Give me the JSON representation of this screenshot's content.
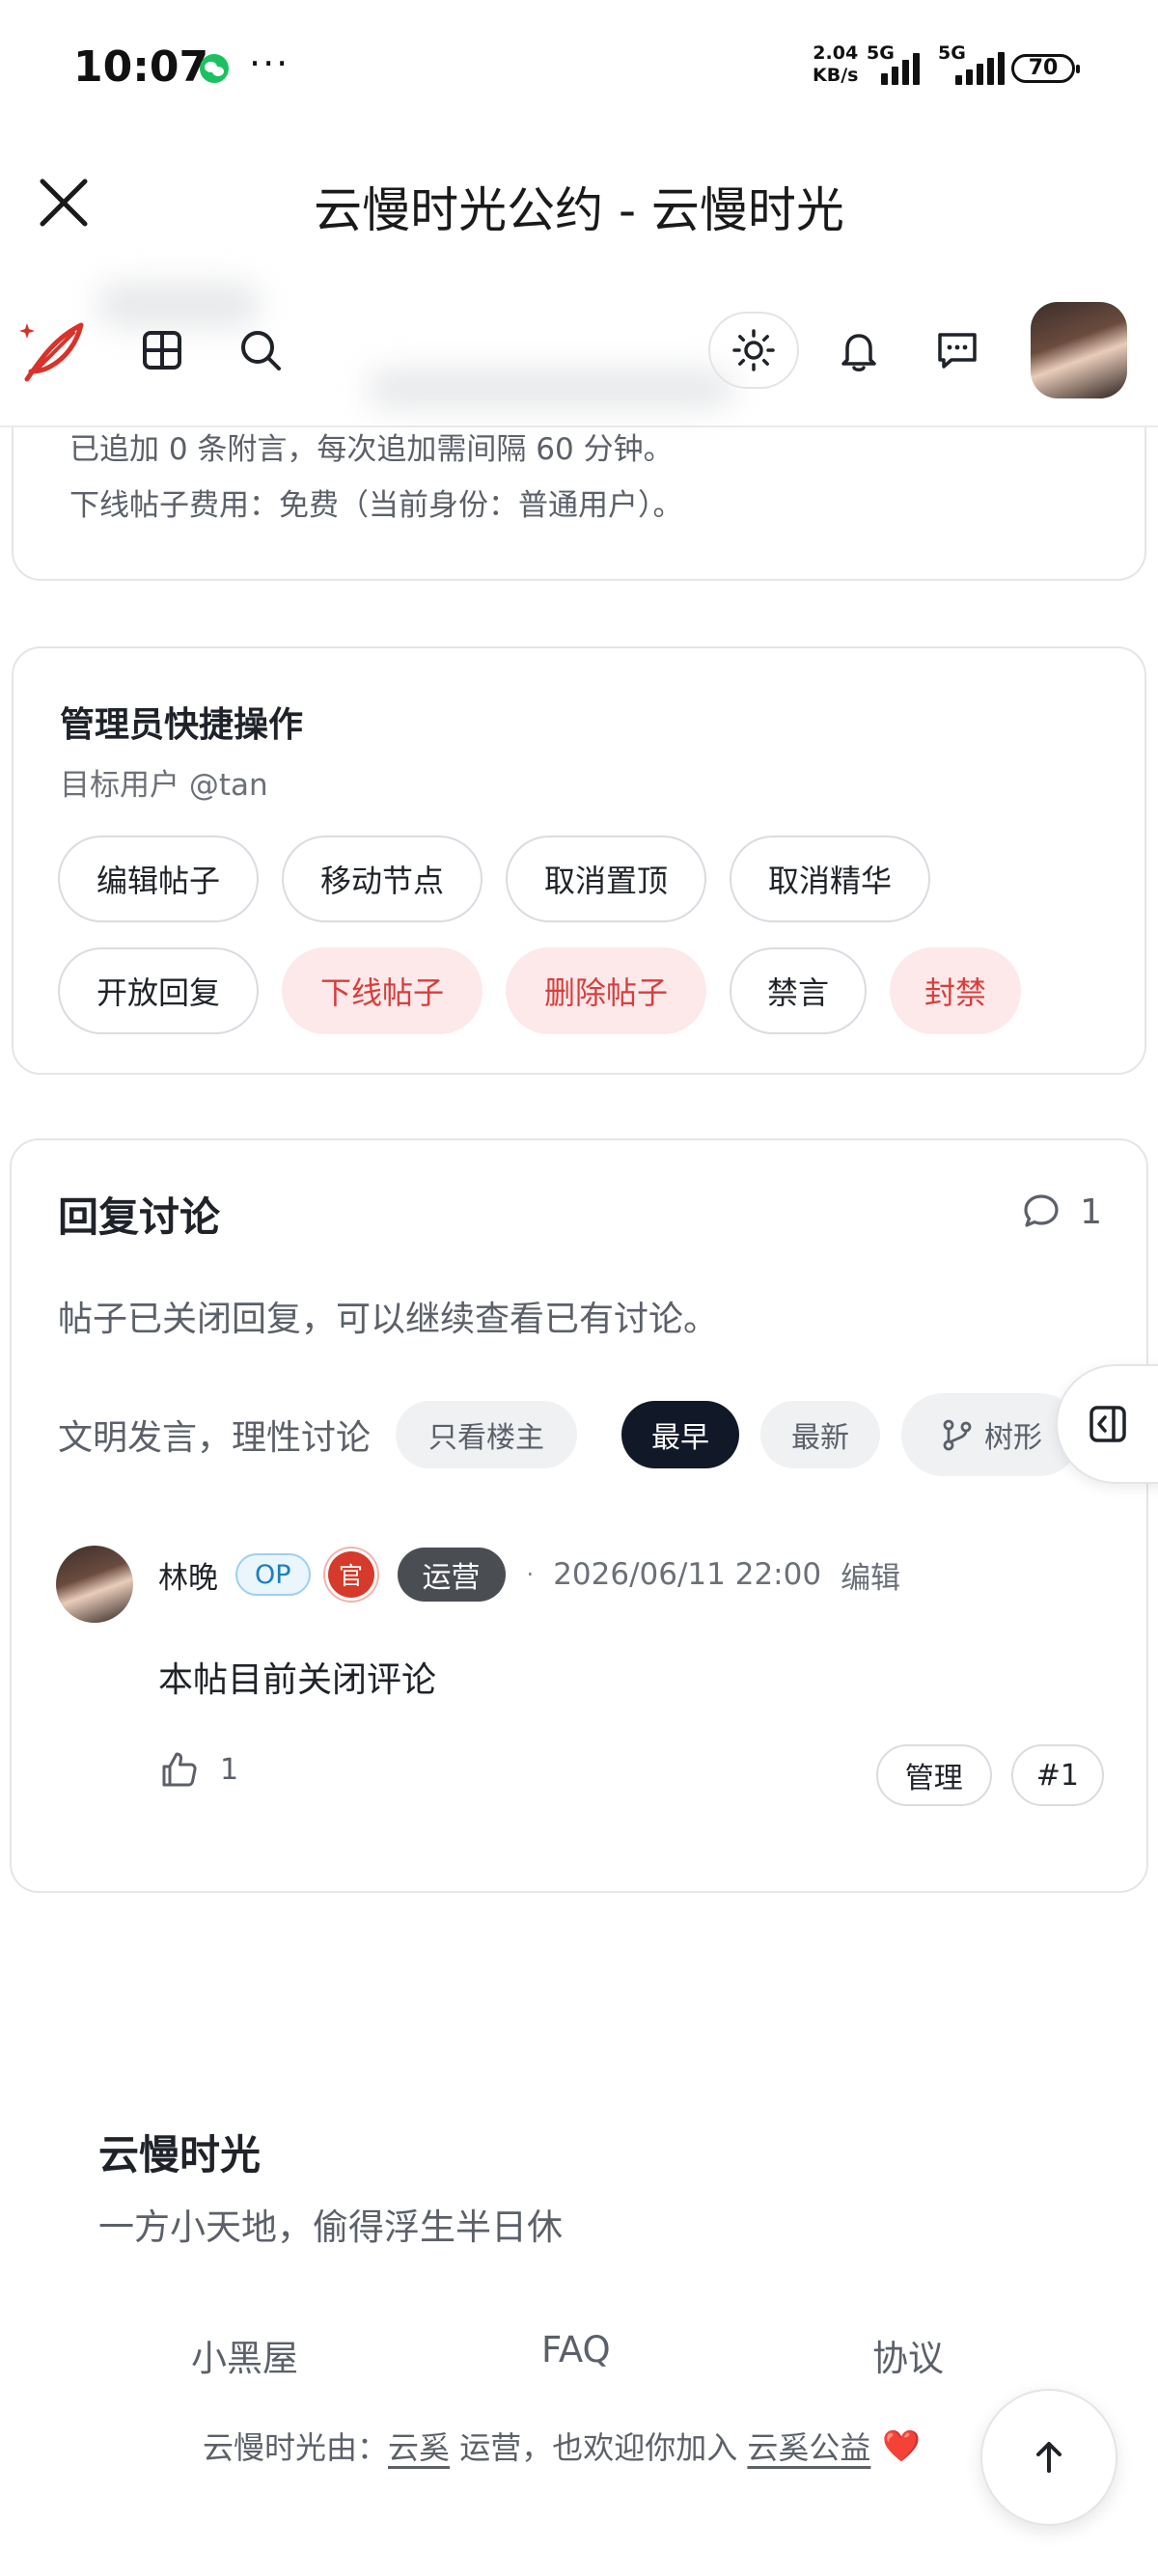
{
  "status_bar": {
    "time": "10:07",
    "dots": "···",
    "speed_value": "2.04",
    "speed_unit": "KB/s",
    "net1": "5G",
    "net2": "5G",
    "battery": "70"
  },
  "title_bar": {
    "title": "云慢时光公约 - 云慢时光"
  },
  "post_info": {
    "addendum_line": "已追加 0 条附言，每次追加需间隔 60 分钟。",
    "offline_fee_line": "下线帖子费用：免费（当前身份：普通用户）。"
  },
  "admin": {
    "title": "管理员快捷操作",
    "target_user": "目标用户 @tan",
    "actions": [
      "编辑帖子",
      "移动节点",
      "取消置顶",
      "取消精华",
      "开放回复",
      "下线帖子",
      "删除帖子",
      "禁言",
      "封禁"
    ]
  },
  "replies": {
    "title": "回复讨论",
    "count": "1",
    "closed_note": "帖子已关闭回复，可以继续查看已有讨论。",
    "filter_label": "文明发言，理性讨论",
    "filters": {
      "op_only": "只看楼主",
      "oldest": "最早",
      "newest": "最新",
      "tree": "树形"
    },
    "comment": {
      "author": "林晚",
      "op_badge": "OP",
      "official_badge": "官",
      "role": "运营",
      "dot": "·",
      "time": "2026/06/11 22:00",
      "edit": "编辑",
      "body": "本帖目前关闭评论",
      "likes": "1",
      "manage": "管理",
      "floor": "#1"
    }
  },
  "footer": {
    "brand": "云慢时光",
    "slogan": "一方小天地，偷得浮生半日休",
    "links": [
      "小黑屋",
      "FAQ",
      "协议"
    ],
    "credit_prefix": "云慢时光由：",
    "credit_org": "云奚",
    "credit_middle": " 运营，也欢迎你加入 ",
    "credit_charity": "云奚公益",
    "heart": "❤️"
  },
  "colors": {
    "accent_dark": "#111827",
    "danger": "#d93d3d",
    "danger_bg": "#fde9e9",
    "logo_red": "#d8322b"
  },
  "icons": [
    "close-icon",
    "feather-logo-icon",
    "grid-icon",
    "search-icon",
    "sun-icon",
    "bell-icon",
    "message-icon",
    "comment-icon",
    "branch-icon",
    "sidebar-toggle-icon",
    "thumbs-up-icon",
    "arrow-up-icon"
  ]
}
